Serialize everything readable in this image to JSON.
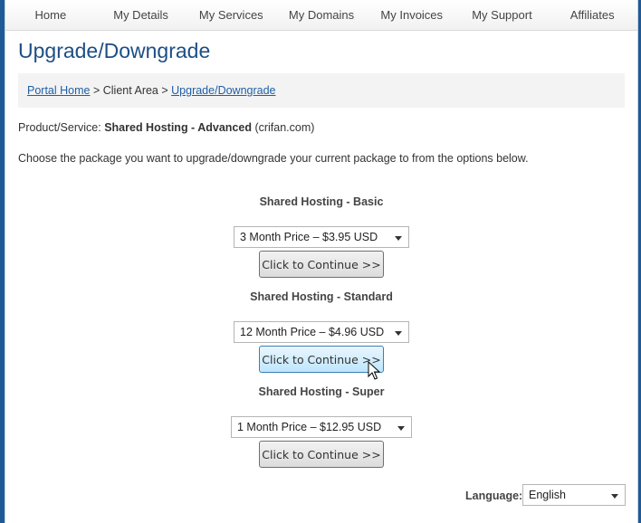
{
  "nav": {
    "items": [
      "Home",
      "My Details",
      "My Services",
      "My Domains",
      "My Invoices",
      "My Support",
      "Affiliates"
    ]
  },
  "page": {
    "title": "Upgrade/Downgrade"
  },
  "breadcrumb": {
    "portal_home": "Portal Home",
    "separator": " > ",
    "client_area": "Client Area",
    "current": "Upgrade/Downgrade"
  },
  "product": {
    "label": "Product/Service:",
    "name": "Shared Hosting - Advanced",
    "domain": "(crifan.com)"
  },
  "instructions": "Choose the package you want to upgrade/downgrade your current package to from the options below.",
  "packages": [
    {
      "name": "Shared Hosting - Basic",
      "selected_cycle": "3 Month Price – $3.95 USD",
      "button_label": "Click to Continue >>"
    },
    {
      "name": "Shared Hosting - Standard",
      "selected_cycle": "12 Month Price – $4.96 USD",
      "button_label": "Click to Continue >>"
    },
    {
      "name": "Shared Hosting - Super",
      "selected_cycle": "1 Month Price – $12.95 USD",
      "button_label": "Click to Continue >>"
    }
  ],
  "language": {
    "label": "Language:",
    "selected": "English"
  }
}
